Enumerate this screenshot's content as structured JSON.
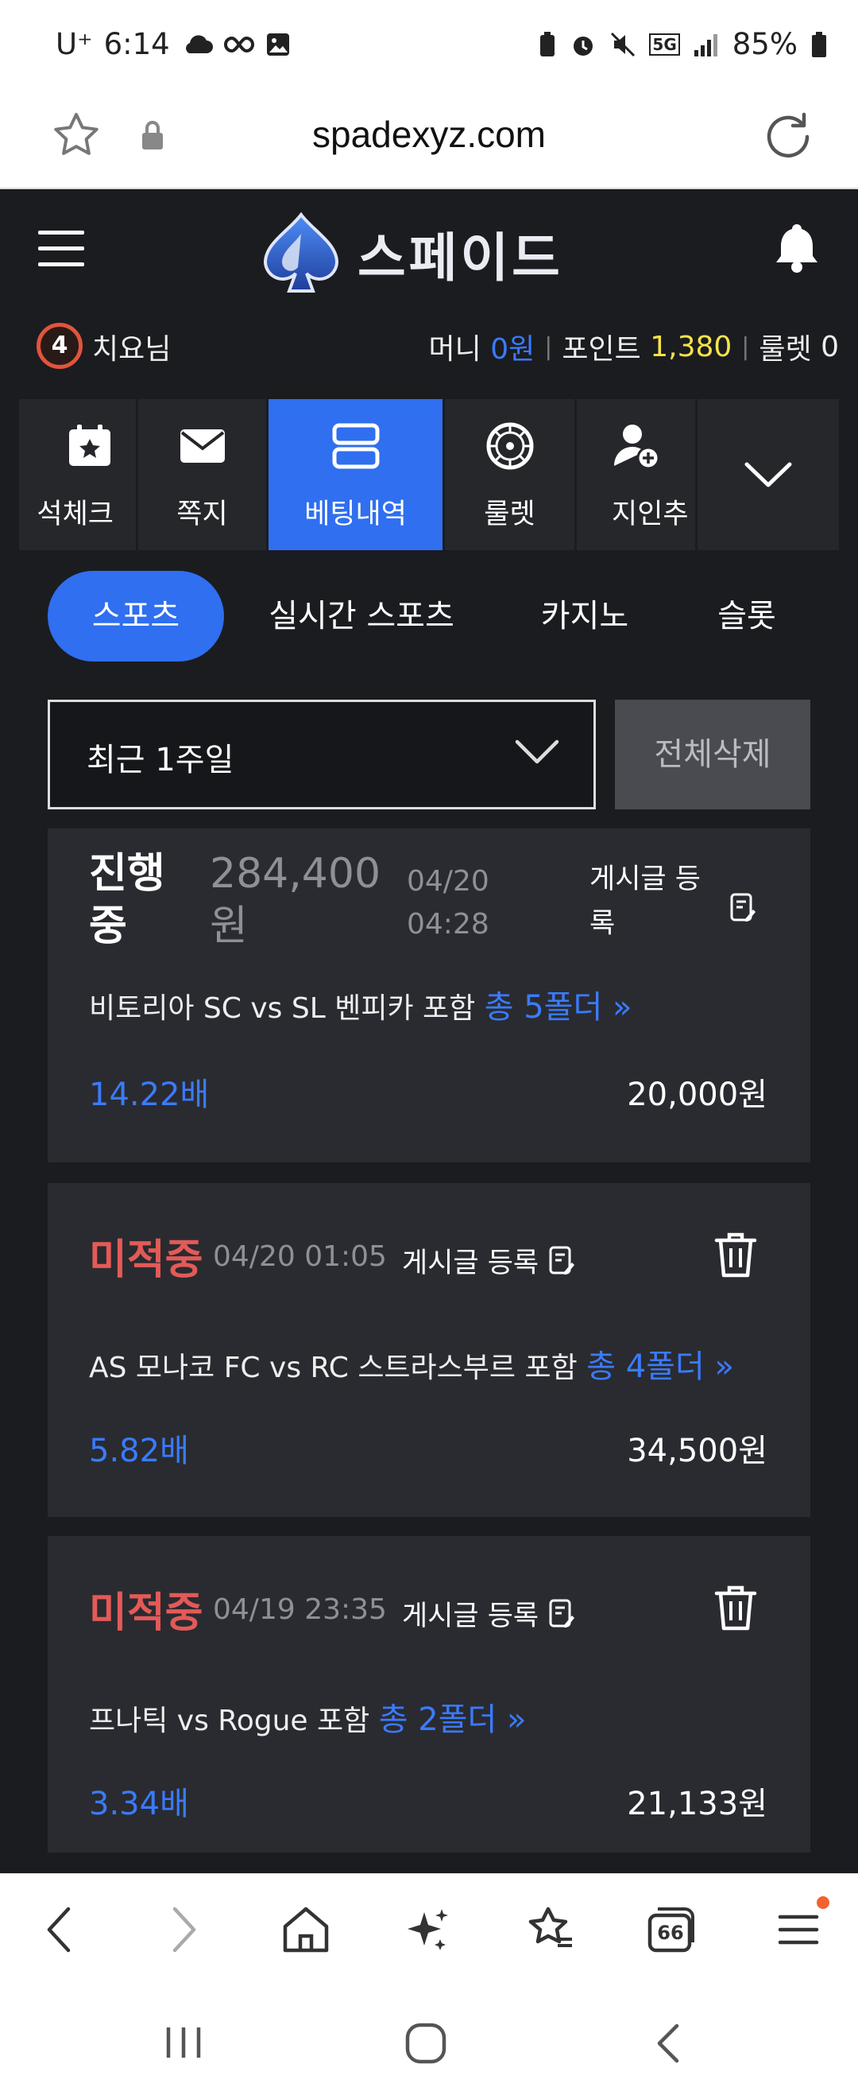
{
  "status_bar": {
    "carrier": "U⁺",
    "time": "6:14",
    "network": "5G",
    "battery": "85%"
  },
  "browser": {
    "url": "spadexyz.com"
  },
  "site": {
    "logo_text": "스페이드"
  },
  "user": {
    "level": "4",
    "name": "치요님",
    "money_label": "머니",
    "money_value": "0원",
    "point_label": "포인트",
    "point_value": "1,380",
    "roulette_label": "룰렛",
    "roulette_value": "0"
  },
  "icon_nav": [
    {
      "label": "석체크",
      "icon": "calendar-star-icon"
    },
    {
      "label": "쪽지",
      "icon": "envelope-icon"
    },
    {
      "label": "베팅내역",
      "icon": "bet-list-icon",
      "active": true
    },
    {
      "label": "룰렛",
      "icon": "roulette-icon"
    },
    {
      "label": "지인추",
      "icon": "add-friend-icon"
    }
  ],
  "tabs": [
    {
      "label": "스포츠",
      "active": true
    },
    {
      "label": "실시간 스포츠"
    },
    {
      "label": "카지노"
    },
    {
      "label": "슬롯"
    }
  ],
  "filter": {
    "period": "최근 1주일",
    "delete_all": "전체삭제"
  },
  "bets": [
    {
      "status": "진행중",
      "status_line1": "진행",
      "status_line2": "중",
      "amount_line1": "284,400",
      "amount_line2": "원",
      "date": "04/20",
      "time": "04:28",
      "post_line1": "게시글 등",
      "post_line2": "록",
      "match": "비토리아 SC vs SL 벤피카 포함",
      "folder": "총 5폴더",
      "odds": "14.22배",
      "stake": "20,000원"
    },
    {
      "status": "미적중",
      "datetime": "04/20 01:05",
      "post": "게시글 등록",
      "match": "AS 모나코 FC vs RC 스트라스부르 포함",
      "folder": "총 4폴더",
      "odds": "5.82배",
      "stake": "34,500원"
    },
    {
      "status": "미적중",
      "datetime": "04/19 23:35",
      "post": "게시글 등록",
      "match": "프나틱 vs Rogue 포함",
      "folder": "총 2폴더",
      "odds": "3.34배",
      "stake": "21,133원"
    }
  ],
  "browser_nav": {
    "tab_count": "66"
  },
  "colors": {
    "accent": "#2f6ff0",
    "lost": "#e35a58",
    "points": "#f6e34a",
    "card": "#2a2b30",
    "bg": "#1b1c20"
  }
}
